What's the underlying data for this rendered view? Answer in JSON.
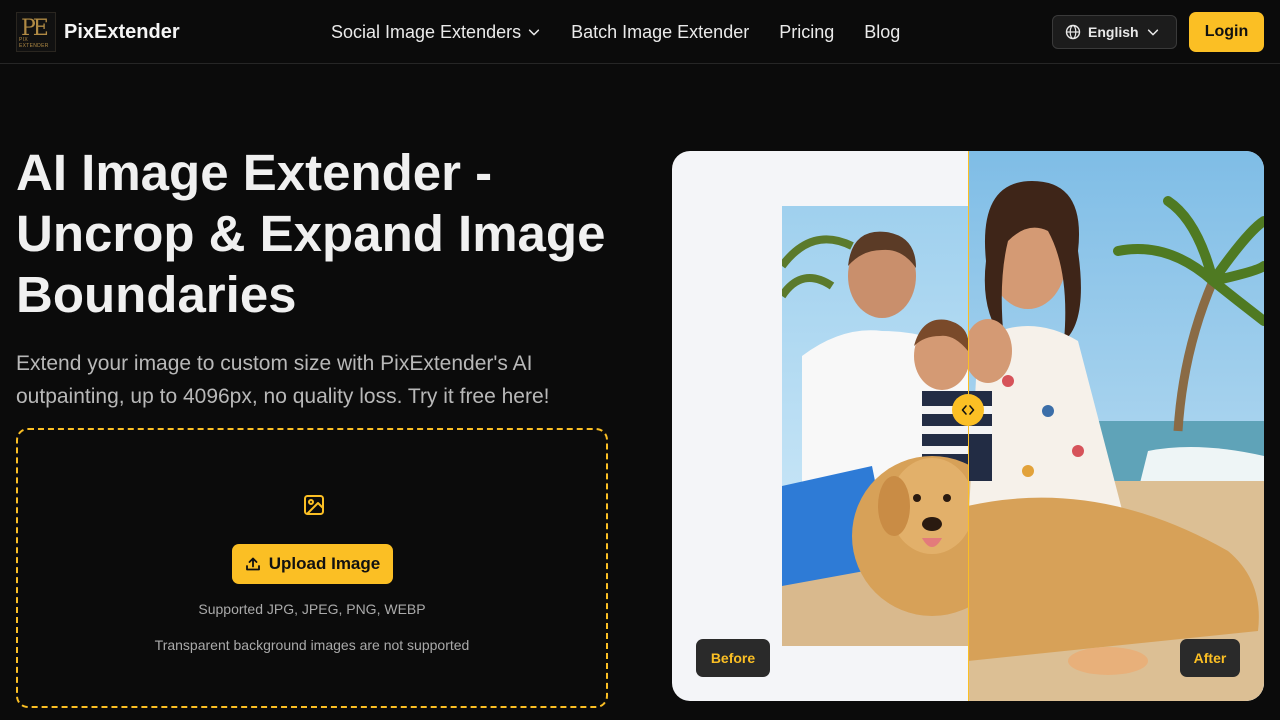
{
  "header": {
    "brand": "PixExtender",
    "logo_mark": "PE",
    "logo_sub": "PIX EXTENDER",
    "nav": [
      {
        "label": "Social Image Extenders",
        "icon": "chevron-down-icon"
      },
      {
        "label": "Batch Image Extender"
      },
      {
        "label": "Pricing"
      },
      {
        "label": "Blog"
      }
    ],
    "language": "English",
    "login": "Login"
  },
  "hero": {
    "title": "AI Image Extender - Uncrop & Expand Image Boundaries",
    "subtitle": "Extend your image to custom size with PixExtender's AI outpainting, up to 4096px, no quality loss. Try it free here!"
  },
  "upload": {
    "icon": "image-icon",
    "button_label": "Upload Image",
    "button_icon": "upload-icon",
    "supported": "Supported JPG, JPEG, PNG, WEBP",
    "note": "Transparent background images are not supported"
  },
  "compare": {
    "before_label": "Before",
    "after_label": "After",
    "handle_icon": "code-arrows-icon"
  },
  "colors": {
    "accent": "#fbbf24",
    "background": "#0b0b0b",
    "panel": "#f4f5f8"
  }
}
